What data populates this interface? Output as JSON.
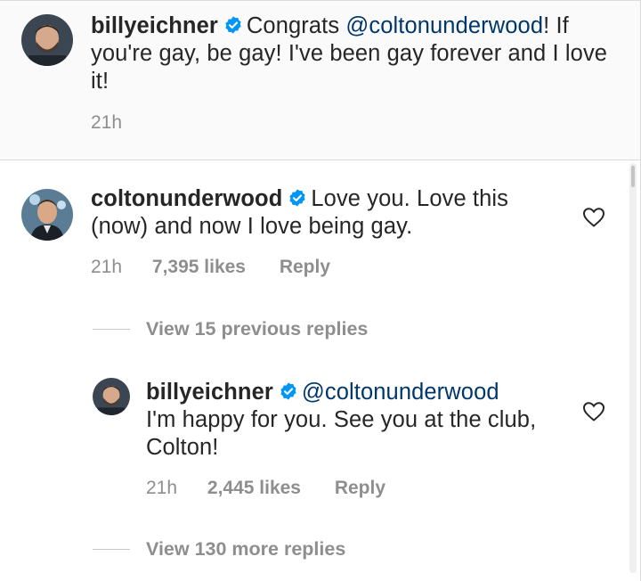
{
  "post_caption": {
    "username": "billyeichner",
    "text_before_mention": "Congrats ",
    "mention": "@coltonunderwood",
    "text_after_mention": "! If you're gay, be gay! I've been gay forever and I love it!",
    "time": "21h"
  },
  "comments": [
    {
      "username": "coltonunderwood",
      "text": "Love you. Love this (now) and now I love being gay.",
      "time": "21h",
      "likes": "7,395 likes",
      "reply_label": "Reply"
    }
  ],
  "view_previous": "View 15 previous replies",
  "reply": {
    "username": "billyeichner",
    "mention": "@coltonunderwood",
    "text": "I'm happy for you. See you at the club, Colton!",
    "time": "21h",
    "likes": "2,445 likes",
    "reply_label": "Reply"
  },
  "view_more": "View 130 more replies",
  "colors": {
    "text": "#262626",
    "muted": "#8e8e8e",
    "verified_badge": "#0095f6",
    "mention": "#00376b",
    "caption_background": "#fafafa"
  },
  "icons": [
    "verified-badge-icon",
    "heart-outline-icon"
  ]
}
